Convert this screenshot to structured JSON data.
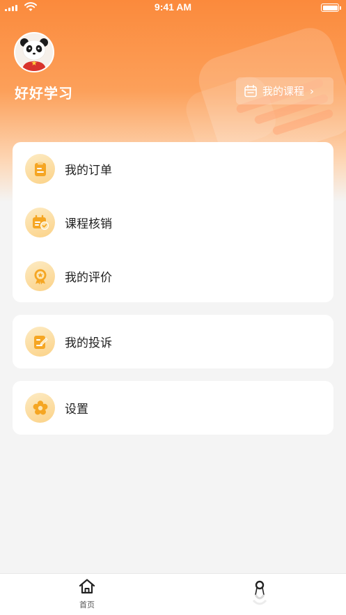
{
  "status_bar": {
    "time": "9:41 AM"
  },
  "profile": {
    "username": "好好学习",
    "avatar_icon": "panda-avatar"
  },
  "header": {
    "my_course_label": "我的课程",
    "my_course_icon": "calendar-icon",
    "chevron": "›"
  },
  "menu_group_1": [
    {
      "label": "我的订单",
      "icon": "clipboard-icon"
    },
    {
      "label": "课程核销",
      "icon": "verify-ticket-icon"
    },
    {
      "label": "我的评价",
      "icon": "star-badge-icon"
    }
  ],
  "menu_group_2": [
    {
      "label": "我的投诉",
      "icon": "edit-note-icon"
    }
  ],
  "menu_group_3": [
    {
      "label": "设置",
      "icon": "gear-flower-icon"
    }
  ],
  "tabbar": {
    "home_label": "首页"
  },
  "colors": {
    "accent": "#fb8a3c",
    "icon_bg": "#fbd287",
    "icon_fg": "#f5a623"
  }
}
